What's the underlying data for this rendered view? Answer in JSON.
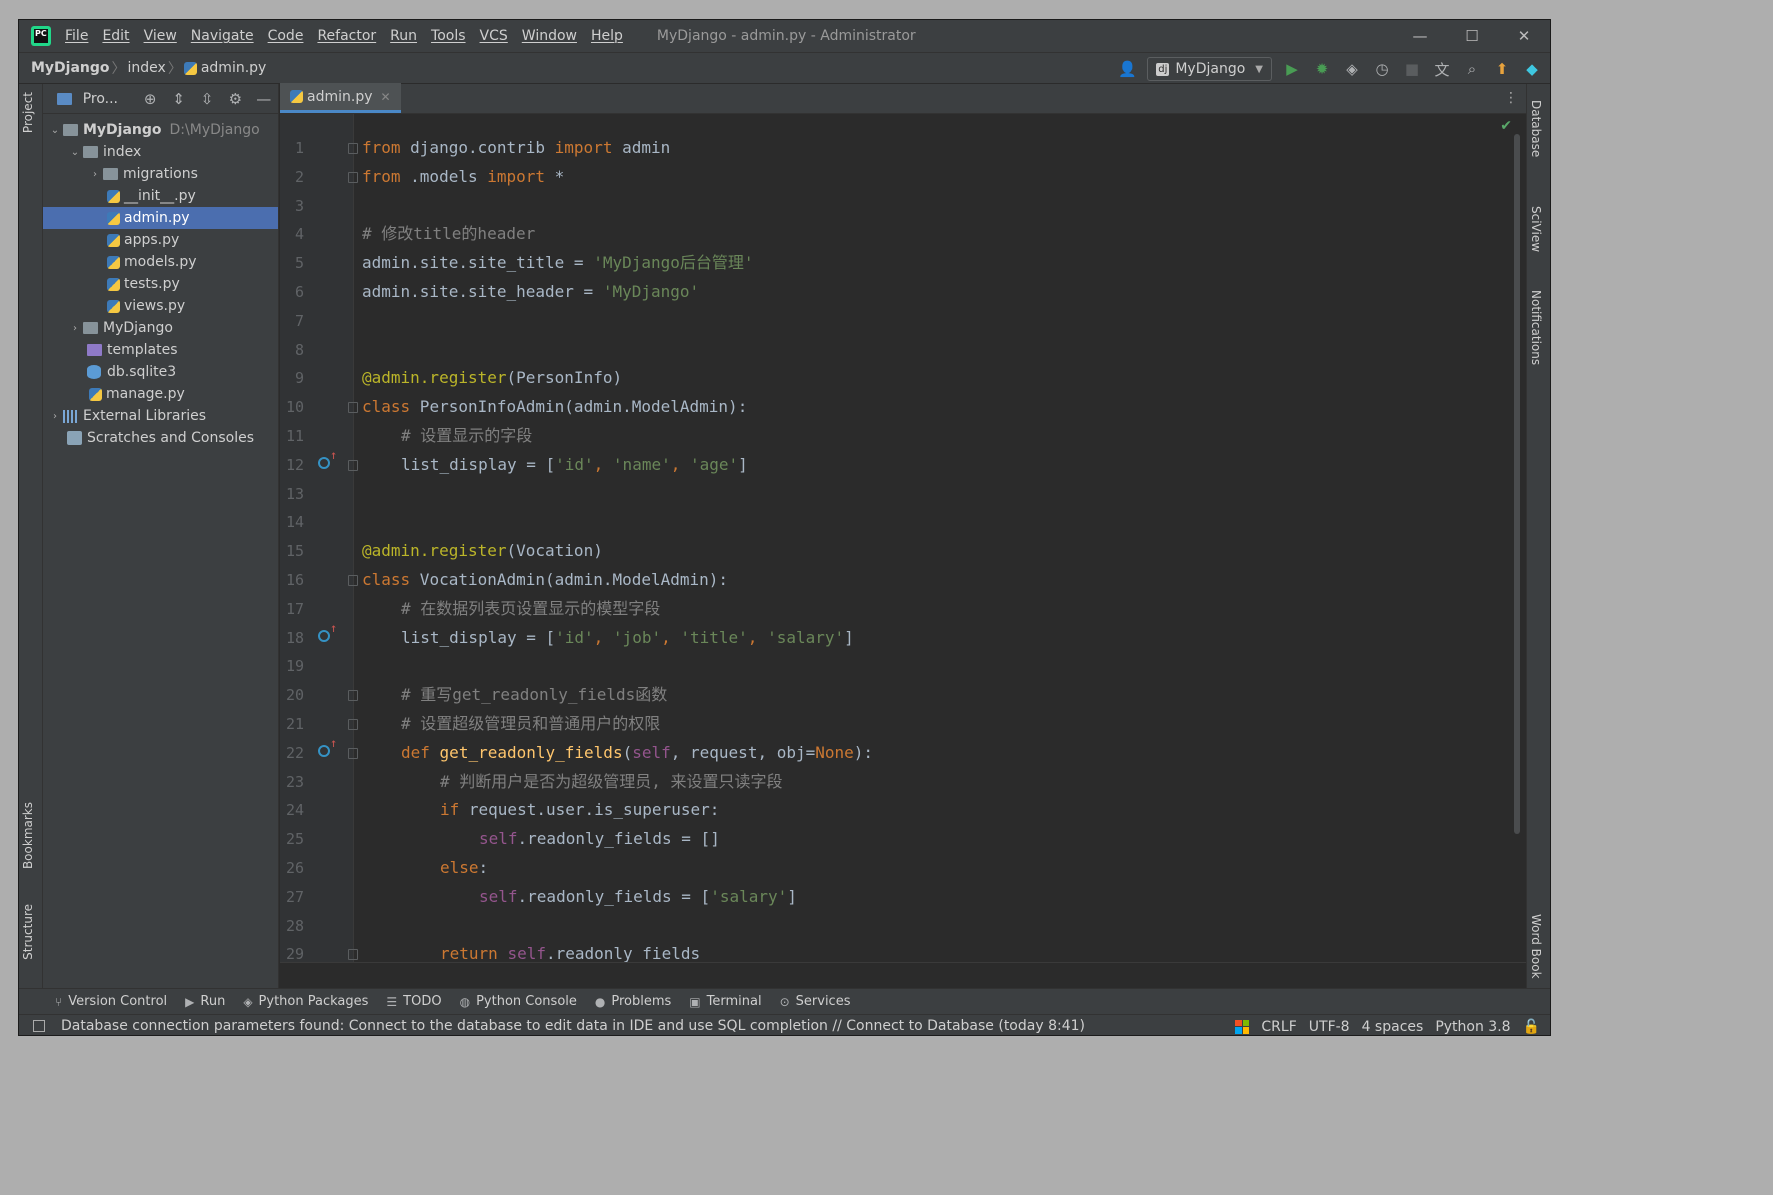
{
  "titlebar": {
    "menu": [
      "File",
      "Edit",
      "View",
      "Navigate",
      "Code",
      "Refactor",
      "Run",
      "Tools",
      "VCS",
      "Window",
      "Help"
    ],
    "title": "MyDjango - admin.py - Administrator"
  },
  "navbar": {
    "crumbs": [
      "MyDjango",
      "index",
      "admin.py"
    ],
    "run_config": "MyDjango"
  },
  "left_tabs": {
    "project": "Project",
    "bookmarks": "Bookmarks",
    "structure": "Structure"
  },
  "right_tabs": {
    "database": "Database",
    "sciview": "SciView",
    "notifications": "Notifications",
    "wordbook": "Word Book"
  },
  "project": {
    "header": "Pro...",
    "root": {
      "name": "MyDjango",
      "path": "D:\\MyDjango"
    },
    "index": "index",
    "migrations": "migrations",
    "files": [
      "__init__.py",
      "admin.py",
      "apps.py",
      "models.py",
      "tests.py",
      "views.py"
    ],
    "mydjango_pkg": "MyDjango",
    "templates": "templates",
    "db": "db.sqlite3",
    "manage": "manage.py",
    "external": "External Libraries",
    "scratches": "Scratches and Consoles"
  },
  "editor": {
    "tab": "admin.py",
    "line_numbers": [
      "1",
      "2",
      "3",
      "4",
      "5",
      "6",
      "7",
      "8",
      "9",
      "10",
      "11",
      "12",
      "13",
      "14",
      "15",
      "16",
      "17",
      "18",
      "19",
      "20",
      "21",
      "22",
      "23",
      "24",
      "25",
      "26",
      "27",
      "28",
      "29"
    ]
  },
  "code": {
    "l1": [
      "from",
      " django.contrib ",
      "import",
      " admin"
    ],
    "l2": [
      "from",
      " .models ",
      "import",
      " *"
    ],
    "l4": "# 修改title的header",
    "l5": [
      "admin.site.site_title = ",
      "'MyDjango后台管理'"
    ],
    "l6": [
      "admin.site.site_header = ",
      "'MyDjango'"
    ],
    "l9": [
      "@admin.register",
      "(PersonInfo)"
    ],
    "l10": [
      "class",
      " PersonInfoAdmin(admin.ModelAdmin):"
    ],
    "l11": "# 设置显示的字段",
    "l12": [
      "list_display = [",
      "'id'",
      ", ",
      "'name'",
      ", ",
      "'age'",
      "]"
    ],
    "l15": [
      "@admin.register",
      "(Vocation)"
    ],
    "l16": [
      "class",
      " VocationAdmin(admin.ModelAdmin):"
    ],
    "l17": "# 在数据列表页设置显示的模型字段",
    "l18": [
      "list_display = [",
      "'id'",
      ", ",
      "'job'",
      ", ",
      "'title'",
      ", ",
      "'salary'",
      "]"
    ],
    "l20": "# 重写get_readonly_fields函数",
    "l21": "# 设置超级管理员和普通用户的权限",
    "l22": [
      "def",
      "get_readonly_fields",
      "(",
      "self",
      ", request, obj=",
      "None",
      "):"
    ],
    "l23": "# 判断用户是否为超级管理员, 来设置只读字段",
    "l24": [
      "if",
      " request.user.is_superuser:"
    ],
    "l25": [
      "self",
      ".readonly_fields = []"
    ],
    "l26": [
      "else",
      ":"
    ],
    "l27": [
      "self",
      ".readonly_fields = [",
      "'salary'",
      "]"
    ],
    "l29": [
      "return",
      "self",
      ".readonly_fields"
    ]
  },
  "toolbar_bottom": [
    "Version Control",
    "Run",
    "Python Packages",
    "TODO",
    "Python Console",
    "Problems",
    "Terminal",
    "Services"
  ],
  "status": {
    "message": "Database connection parameters found: Connect to the database to edit data in IDE and use SQL completion // Connect to Database (today 8:41)",
    "line_sep": "CRLF",
    "encoding": "UTF-8",
    "indent": "4 spaces",
    "interpreter": "Python 3.8"
  },
  "colors": {
    "accent": "#4b6eaf",
    "keyword": "#cc7832",
    "string": "#6a8759",
    "comment": "#808080",
    "decorator": "#bbb529",
    "self": "#94558d",
    "function": "#ffc66d"
  }
}
